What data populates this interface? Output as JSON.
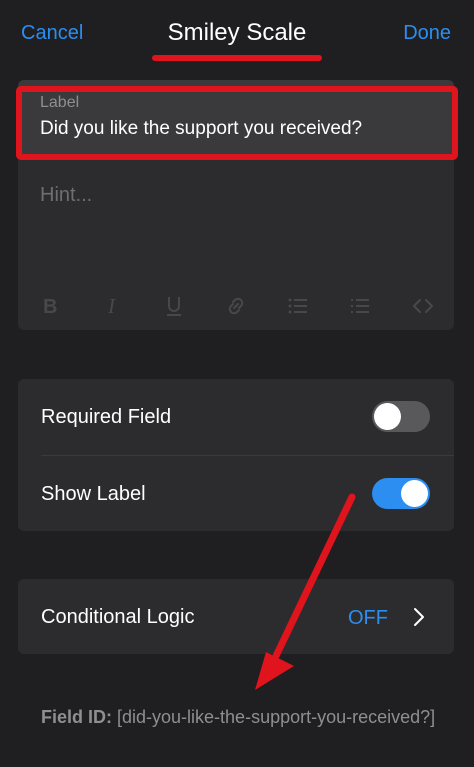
{
  "nav": {
    "cancel_label": "Cancel",
    "title": "Smiley Scale",
    "done_label": "Done"
  },
  "label_field": {
    "caption": "Label",
    "value": "Did you like the support you received?"
  },
  "hint_field": {
    "placeholder": "Hint..."
  },
  "toolbar": {
    "icons": [
      "bold-icon",
      "italic-icon",
      "underline-icon",
      "link-icon",
      "bulleted-list-icon",
      "numbered-list-icon",
      "code-icon"
    ]
  },
  "settings": {
    "required_field": {
      "label": "Required Field",
      "on": false
    },
    "show_label": {
      "label": "Show Label",
      "on": true
    }
  },
  "conditional_logic": {
    "label": "Conditional Logic",
    "value": "OFF"
  },
  "field_id": {
    "key": "Field ID:",
    "value": "[did-you-like-the-support-you-received?]"
  },
  "colors": {
    "accent": "#2b8ef0",
    "annotation": "#e0141c",
    "background": "#1f1f21",
    "card": "#2c2c2e"
  }
}
